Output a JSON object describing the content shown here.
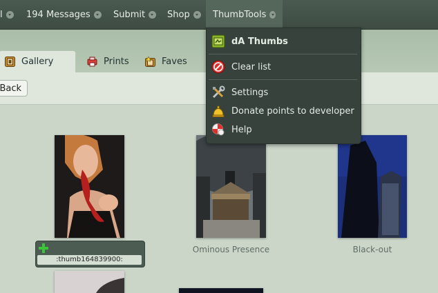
{
  "topnav": {
    "items": [
      {
        "label": "l"
      },
      {
        "label": "194 Messages"
      },
      {
        "label": "Submit"
      },
      {
        "label": "Shop"
      },
      {
        "label": "ThumbTools"
      }
    ]
  },
  "tabs": [
    {
      "label": "Gallery",
      "icon": "gallery-icon"
    },
    {
      "label": "Prints",
      "icon": "prints-icon"
    },
    {
      "label": "Faves",
      "icon": "faves-icon"
    }
  ],
  "toolbar": {
    "back_label": "Back"
  },
  "gallery": {
    "thumbs": [
      {
        "caption": "",
        "code": ":thumb164839900:"
      },
      {
        "caption": "Ominous Presence"
      },
      {
        "caption": "Black-out"
      }
    ]
  },
  "menu": {
    "header": "dA Thumbs",
    "items": [
      {
        "label": "Clear list",
        "icon": "no-entry-icon"
      },
      {
        "label": "Settings",
        "icon": "tools-icon"
      },
      {
        "label": "Donate points to developer",
        "icon": "bell-icon"
      },
      {
        "label": "Help",
        "icon": "help-icon"
      }
    ]
  },
  "colors": {
    "background": "#cbd6c9",
    "nav": "#3e4c43",
    "menu": "#36423b",
    "accent_green": "#3cc43a"
  }
}
